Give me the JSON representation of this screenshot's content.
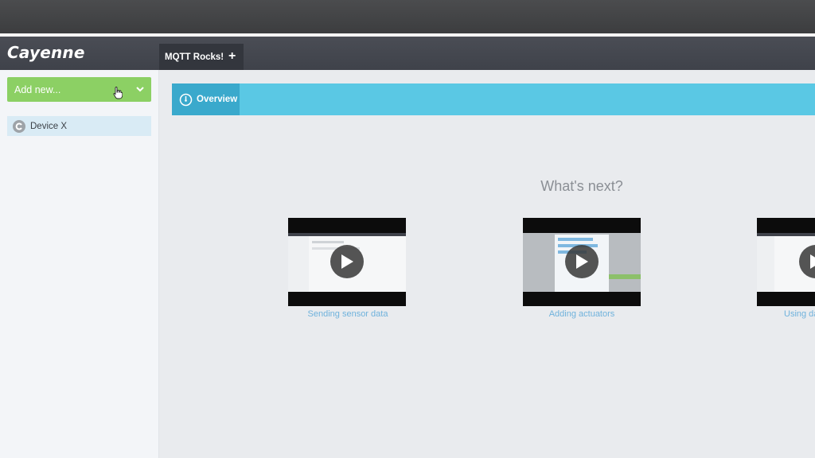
{
  "app": {
    "logo": "Cayenne"
  },
  "tabs": [
    {
      "label": "MQTT Rocks!",
      "add_icon": "plus-icon"
    }
  ],
  "sidebar": {
    "add_button": {
      "label": "Add new...",
      "icon": "chevron-down-icon"
    },
    "devices": [
      {
        "label": "Device X",
        "icon": "cayenne-device-icon"
      }
    ]
  },
  "overview": {
    "tab_label": "Overview",
    "icon": "dashboard-gauge-icon"
  },
  "main": {
    "heading": "What's next?",
    "videos": [
      {
        "label": "Sending sensor data"
      },
      {
        "label": "Adding actuators"
      },
      {
        "label": "Using da"
      }
    ]
  },
  "colors": {
    "accent": "#5ac8e4",
    "accent_dark": "#3aa9cc",
    "add_button": "#8cd064",
    "link": "#6fb2dc"
  }
}
